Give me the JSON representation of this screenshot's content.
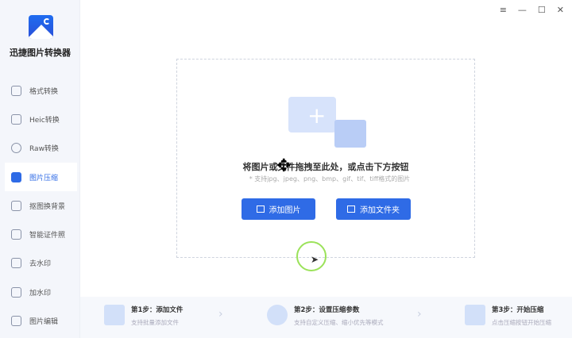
{
  "app": {
    "name": "迅捷图片转换器"
  },
  "window_controls": [
    "≡",
    "—",
    "☐",
    "✕"
  ],
  "sidebar": {
    "items": [
      {
        "label": "格式转换",
        "icon": "format-icon"
      },
      {
        "label": "Heic转换",
        "icon": "heic-icon"
      },
      {
        "label": "Raw转换",
        "icon": "raw-icon"
      },
      {
        "label": "图片压缩",
        "icon": "compress-icon",
        "active": true
      },
      {
        "label": "抠图换背景",
        "icon": "cutout-icon"
      },
      {
        "label": "智能证件照",
        "icon": "id-photo-icon"
      },
      {
        "label": "去水印",
        "icon": "remove-watermark-icon"
      },
      {
        "label": "加水印",
        "icon": "add-watermark-icon"
      },
      {
        "label": "图片编辑",
        "icon": "edit-icon"
      }
    ]
  },
  "drop": {
    "title": "将图片或文件拖拽至此处，或点击下方按钮",
    "subtitle": "* 支持jpg、jpeg、png、bmp、gif、tif、tiff格式的图片",
    "add_image": "添加图片",
    "add_folder": "添加文件夹"
  },
  "steps": [
    {
      "title": "第1步：添加文件",
      "desc": "支持批量添加文件"
    },
    {
      "title": "第2步：设置压缩参数",
      "desc": "支持自定义压缩、缩小优先等模式"
    },
    {
      "title": "第3步：开始压缩",
      "desc": "点击压缩按钮开始压缩"
    }
  ],
  "colors": {
    "accent": "#2f6be6"
  }
}
